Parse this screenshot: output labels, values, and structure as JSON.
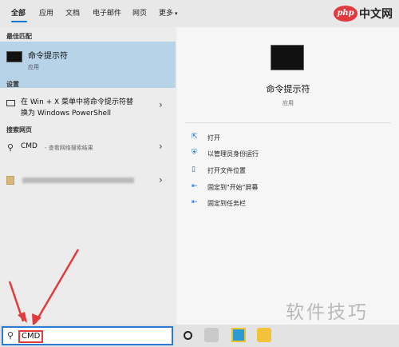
{
  "tabs": [
    {
      "label": "全部",
      "active": true
    },
    {
      "label": "应用",
      "active": false
    },
    {
      "label": "文档",
      "active": false
    },
    {
      "label": "电子邮件",
      "active": false
    },
    {
      "label": "网页",
      "active": false
    },
    {
      "label": "更多",
      "active": false
    }
  ],
  "tabs_more_caret": "▾",
  "logo": {
    "badge": "php",
    "text": "中文网"
  },
  "sections": {
    "best_match": "最佳匹配",
    "settings": "设置",
    "web": "搜索网页"
  },
  "best_match": {
    "title": "命令提示符",
    "subtitle": "应用"
  },
  "setting_item": {
    "line1": "在 Win + X 菜单中将命令提示符替",
    "line2": "换为 Windows PowerShell"
  },
  "web_item": {
    "label": "CMD",
    "description": "- 查看网络搜索结果"
  },
  "chevron": "›",
  "details": {
    "title": "命令提示符",
    "subtitle": "应用",
    "actions": [
      {
        "icon": "open-icon",
        "glyph": "⇱",
        "label": "打开"
      },
      {
        "icon": "admin-icon",
        "glyph": "⛨",
        "label": "以管理员身份运行"
      },
      {
        "icon": "folder-icon",
        "glyph": "▯",
        "label": "打开文件位置"
      },
      {
        "icon": "pin-start-icon",
        "glyph": "⇤",
        "label": "固定到\"开始\"屏幕"
      },
      {
        "icon": "pin-taskbar-icon",
        "glyph": "⇤",
        "label": "固定到任务栏"
      }
    ]
  },
  "search": {
    "glass": "⚲",
    "value": "CMD"
  },
  "watermark": "软件技巧",
  "colors": {
    "accent": "#0078d4",
    "selected_bg": "#b7d3e8",
    "annotation_red": "#e23b3b"
  }
}
